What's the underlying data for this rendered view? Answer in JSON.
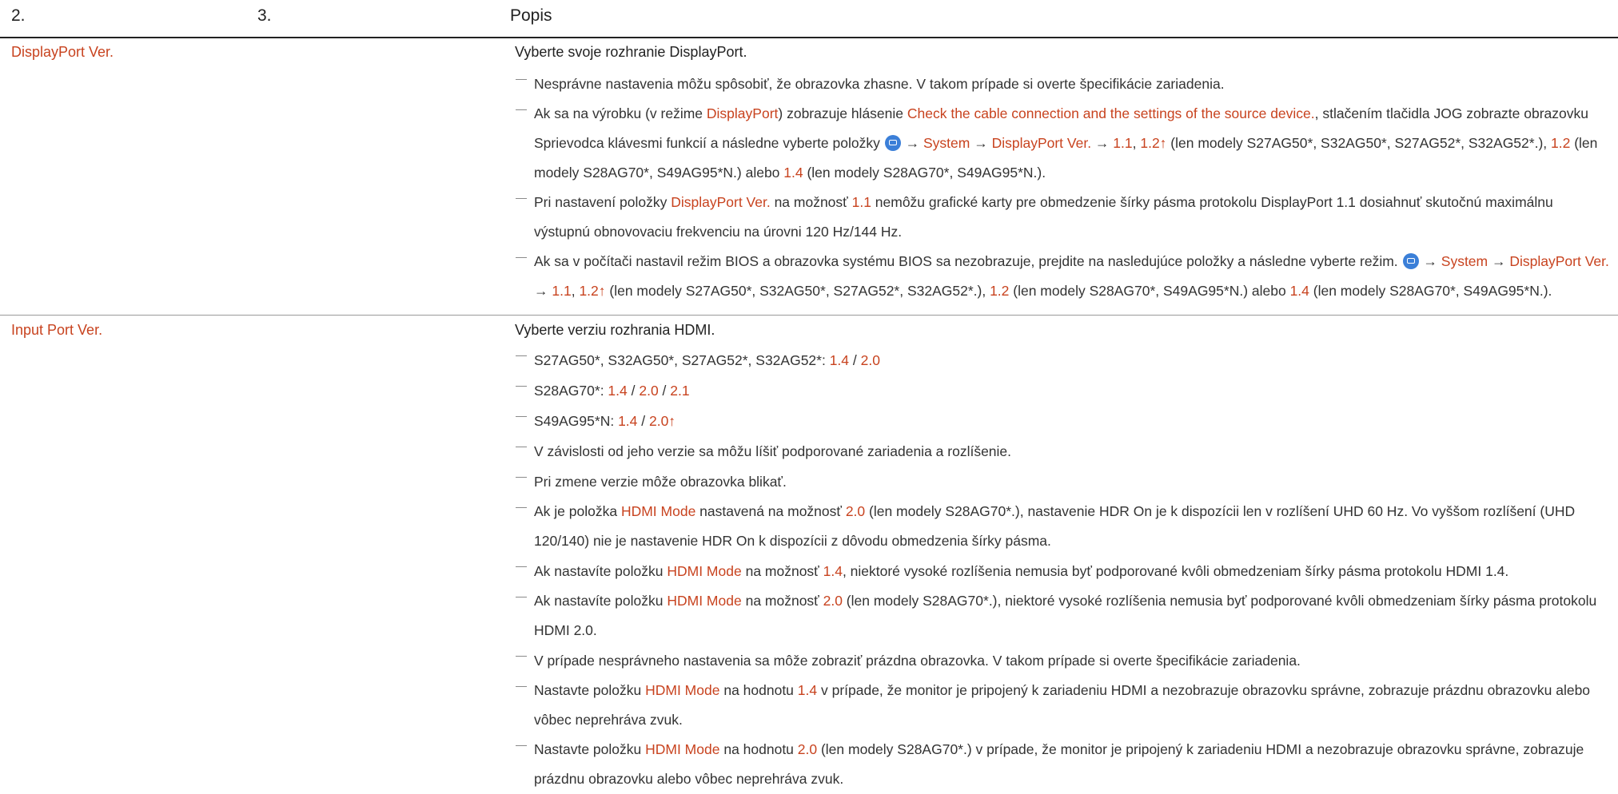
{
  "header": {
    "col2": "2.",
    "col3": "3.",
    "col4": "Popis"
  },
  "rows": [
    {
      "name": "DisplayPort Ver.",
      "description": "Vyberte svoje rozhranie DisplayPort.",
      "notes": [
        "Nesprávne nastavenia môžu spôsobiť, že obrazovka zhasne. V takom prípade si overte špecifikácie zariadenia.",
        "Ak sa na výrobku (v režime [[DisplayPort]]) zobrazuje hlásenie [[Check the cable connection and the settings of the source device.]], stlačením tlačidla JOG zobrazte obrazovku Sprievodca klávesmi funkcií a následne vyberte položky {{icon}} → [[System]] → [[DisplayPort Ver.]] → [[1.1]], [[1.2↑]] (len modely S27AG50*, S32AG50*, S27AG52*, S32AG52*.), [[1.2]] (len modely S28AG70*, S49AG95*N.) alebo [[1.4]] (len modely S28AG70*, S49AG95*N.).",
        "Pri nastavení položky [[DisplayPort Ver.]] na možnosť [[1.1]] nemôžu grafické karty pre obmedzenie šírky pásma protokolu DisplayPort 1.1 dosiahnuť skutočnú maximálnu výstupnú obnovovaciu frekvenciu na úrovni 120 Hz/144 Hz.",
        "Ak sa v počítači nastavil režim BIOS a obrazovka systému BIOS sa nezobrazuje, prejdite na nasledujúce položky a následne vyberte režim. {{icon}} → [[System]] → [[DisplayPort Ver.]] → [[1.1]], [[1.2↑]] (len modely S27AG50*, S32AG50*, S27AG52*, S32AG52*.), [[1.2]] (len modely S28AG70*, S49AG95*N.) alebo [[1.4]] (len modely S28AG70*, S49AG95*N.)."
      ]
    },
    {
      "name": "Input Port Ver.",
      "description": "Vyberte verziu rozhrania HDMI.",
      "notes": [
        "S27AG50*, S32AG50*, S27AG52*, S32AG52*: [[1.4]] / [[2.0]]",
        "S28AG70*: [[1.4]] / [[2.0]] / [[2.1]]",
        "S49AG95*N: [[1.4]] / [[2.0↑]]",
        "V závislosti od jeho verzie sa môžu líšiť podporované zariadenia a rozlíšenie.",
        "Pri zmene verzie môže obrazovka blikať.",
        "Ak je položka [[HDMI Mode]] nastavená na možnosť [[2.0]] (len modely S28AG70*.), nastavenie HDR On je k dispozícii len v rozlíšení UHD 60 Hz. Vo vyššom rozlíšení (UHD 120/140) nie je nastavenie HDR On k dispozícii z dôvodu obmedzenia šírky pásma.",
        "Ak nastavíte položku [[HDMI Mode]] na možnosť [[1.4]], niektoré vysoké rozlíšenia nemusia byť podporované kvôli obmedzeniam šírky pásma protokolu HDMI 1.4.",
        "Ak nastavíte položku [[HDMI Mode]] na možnosť [[2.0]] (len modely S28AG70*.), niektoré vysoké rozlíšenia nemusia byť podporované kvôli obmedzeniam šírky pásma protokolu HDMI 2.0.",
        "V prípade nesprávneho nastavenia sa môže zobraziť prázdna obrazovka. V takom prípade si overte špecifikácie zariadenia.",
        "Nastavte položku [[HDMI Mode]] na hodnotu [[1.4]] v prípade, že monitor je pripojený k zariadeniu HDMI a nezobrazuje obrazovku správne, zobrazuje prázdnu obrazovku alebo vôbec neprehráva zvuk.",
        "Nastavte položku [[HDMI Mode]] na hodnotu [[2.0]] (len modely S28AG70*.) v prípade, že monitor je pripojený k zariadeniu HDMI a nezobrazuje obrazovku správne, zobrazuje prázdnu obrazovku alebo vôbec neprehráva zvuk."
      ]
    }
  ],
  "colors": {
    "highlight": "#c8431f",
    "text": "#333333",
    "menu_icon": "#3b7fd8"
  }
}
